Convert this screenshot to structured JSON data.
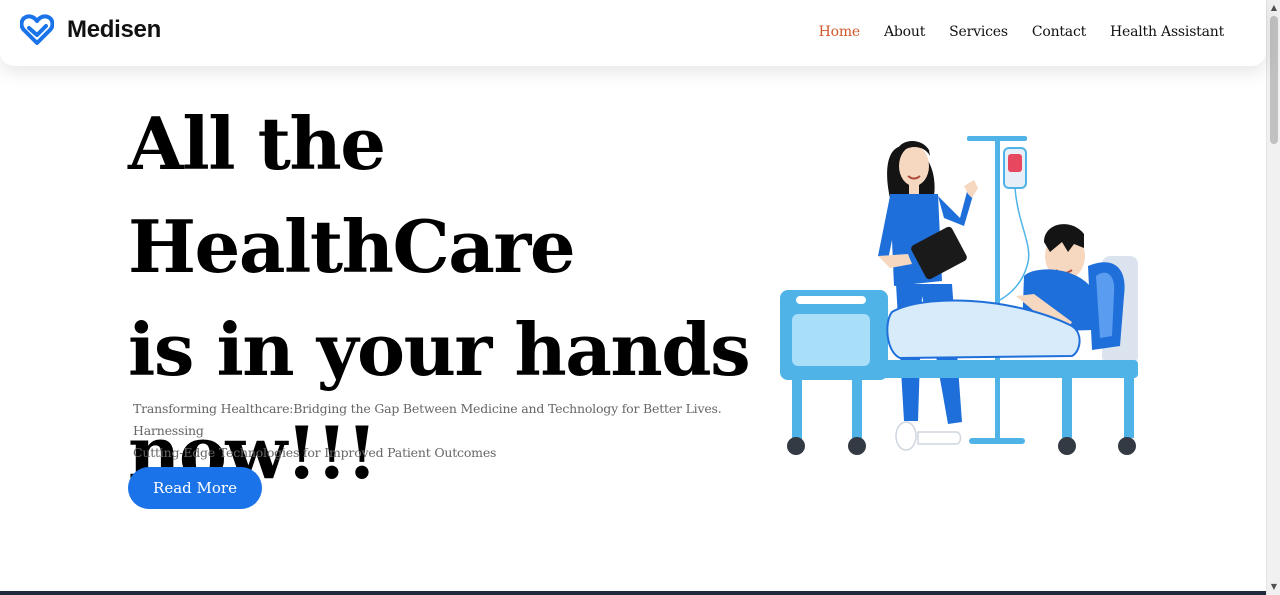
{
  "brand": {
    "name": "Medisen",
    "logo_icon": "heart-logo-icon",
    "color": "#1a73e8"
  },
  "nav": {
    "items": [
      {
        "label": "Home",
        "active": true
      },
      {
        "label": "About",
        "active": false
      },
      {
        "label": "Services",
        "active": false
      },
      {
        "label": "Contact",
        "active": false
      },
      {
        "label": "Health Assistant",
        "active": false
      }
    ],
    "active_color": "#d2572a"
  },
  "hero": {
    "title_lines": [
      "All the HealthCare",
      "is in your hands",
      "now!!!"
    ],
    "subtitle_lines": [
      "Transforming Healthcare:Bridging the Gap Between Medicine and Technology for Better Lives. Harnessing",
      "Cutting-Edge Technologies for Improved Patient Outcomes"
    ],
    "cta_label": "Read More",
    "illustration": "doctor-patient-hospital-bed-illustration"
  },
  "colors": {
    "primary": "#1a73e8",
    "bed_blue": "#4fb3e8",
    "scrub_blue": "#1e6fd9"
  }
}
